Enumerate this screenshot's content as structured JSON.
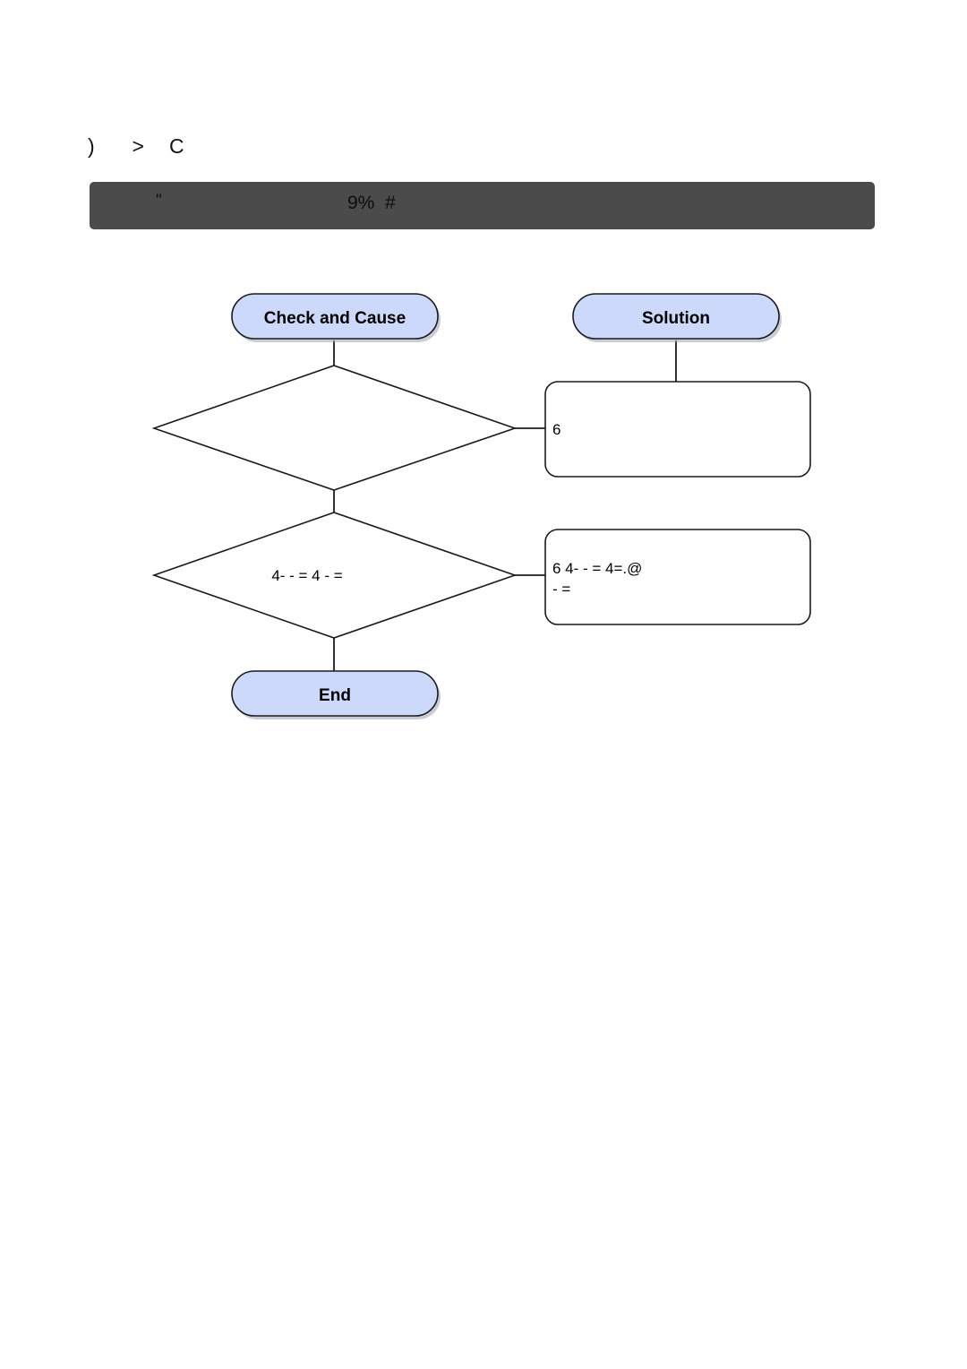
{
  "page": {
    "background": "#ffffff",
    "breadcrumb": ")      >    C"
  },
  "titlebar": {
    "background": "#4b4b4b",
    "left_text": "\"",
    "center_text": "9%  #"
  },
  "flowchart": {
    "columns": [
      {
        "label": "Check and Cause"
      },
      {
        "label": "Solution"
      }
    ],
    "nodes": [
      {
        "id": "check-and-cause-header",
        "type": "terminator",
        "label": "Check and Cause",
        "fill": "#ccd9fb"
      },
      {
        "id": "solution-header",
        "type": "terminator",
        "label": "Solution",
        "fill": "#ccd9fb"
      },
      {
        "id": "decision-1",
        "type": "decision",
        "label": ""
      },
      {
        "id": "solution-box-1",
        "type": "process",
        "line1": "6",
        "line2": ""
      },
      {
        "id": "decision-2",
        "type": "decision",
        "label": "4-  - =   4    - ="
      },
      {
        "id": "solution-box-2",
        "type": "process",
        "line1": "6              4-  - =    4=.@",
        "line2": "- ="
      },
      {
        "id": "end-node",
        "type": "terminator",
        "label": "End",
        "fill": "#ccd9fb"
      }
    ]
  },
  "colors": {
    "node_fill": "#ccd9fb",
    "node_stroke": "#1a1a1a",
    "titlebar": "#4b4b4b",
    "text": "#000000"
  }
}
